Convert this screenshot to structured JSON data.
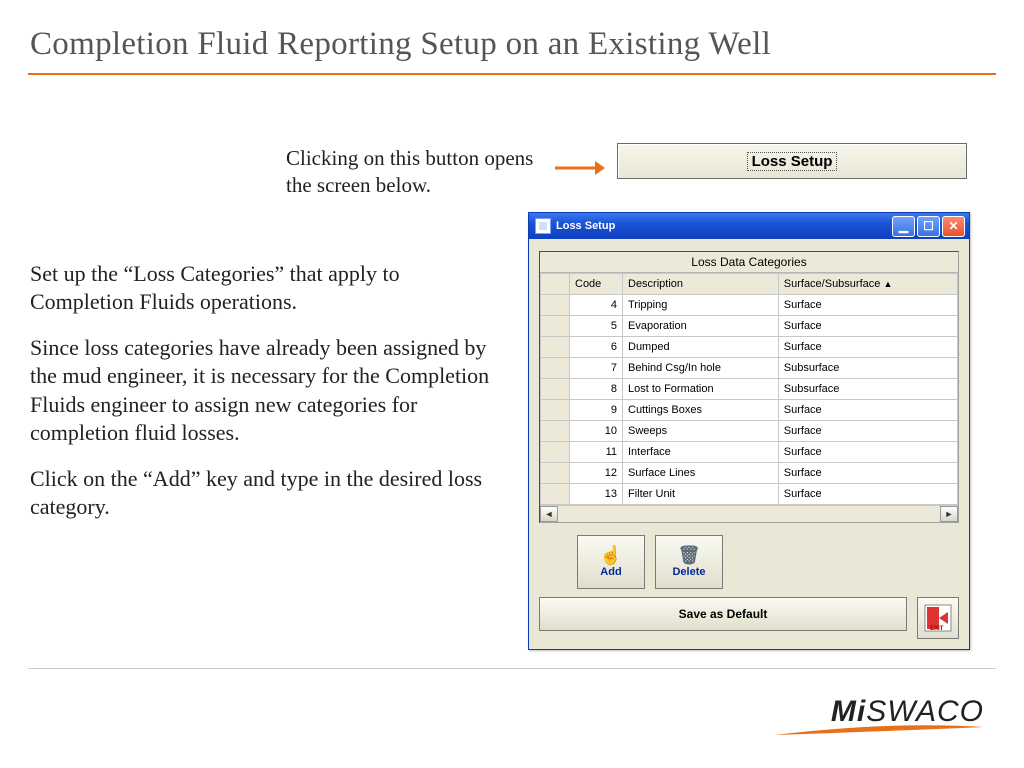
{
  "title": "Completion Fluid Reporting Setup on an Existing Well",
  "caption": "Clicking on this button opens the screen below.",
  "loss_setup_button": "Loss Setup",
  "paragraphs": {
    "p1": "Set up the “Loss Categories” that apply to Completion Fluids operations.",
    "p2": "Since loss categories have already been assigned by the mud engineer, it is necessary for the Completion Fluids engineer to assign new categories for completion fluid losses.",
    "p3": "Click on the “Add” key and type in the desired loss category."
  },
  "window": {
    "title": "Loss Setup",
    "grid_caption": "Loss Data Categories",
    "headers": {
      "code": "Code",
      "description": "Description",
      "surfsub": "Surface/Subsurface"
    },
    "rows": [
      {
        "code": "4",
        "description": "Tripping",
        "surfsub": "Surface"
      },
      {
        "code": "5",
        "description": "Evaporation",
        "surfsub": "Surface"
      },
      {
        "code": "6",
        "description": "Dumped",
        "surfsub": "Surface"
      },
      {
        "code": "7",
        "description": "Behind Csg/In hole",
        "surfsub": "Subsurface"
      },
      {
        "code": "8",
        "description": "Lost to Formation",
        "surfsub": "Subsurface"
      },
      {
        "code": "9",
        "description": "Cuttings Boxes",
        "surfsub": "Surface"
      },
      {
        "code": "10",
        "description": "Sweeps",
        "surfsub": "Surface"
      },
      {
        "code": "11",
        "description": "Interface",
        "surfsub": "Surface"
      },
      {
        "code": "12",
        "description": "Surface Lines",
        "surfsub": "Surface"
      },
      {
        "code": "13",
        "description": "Filter Unit",
        "surfsub": "Surface"
      }
    ],
    "buttons": {
      "add": "Add",
      "delete": "Delete",
      "save_default": "Save as Default"
    }
  },
  "logo": {
    "part1": "Mi",
    "part2": "SWACO"
  }
}
